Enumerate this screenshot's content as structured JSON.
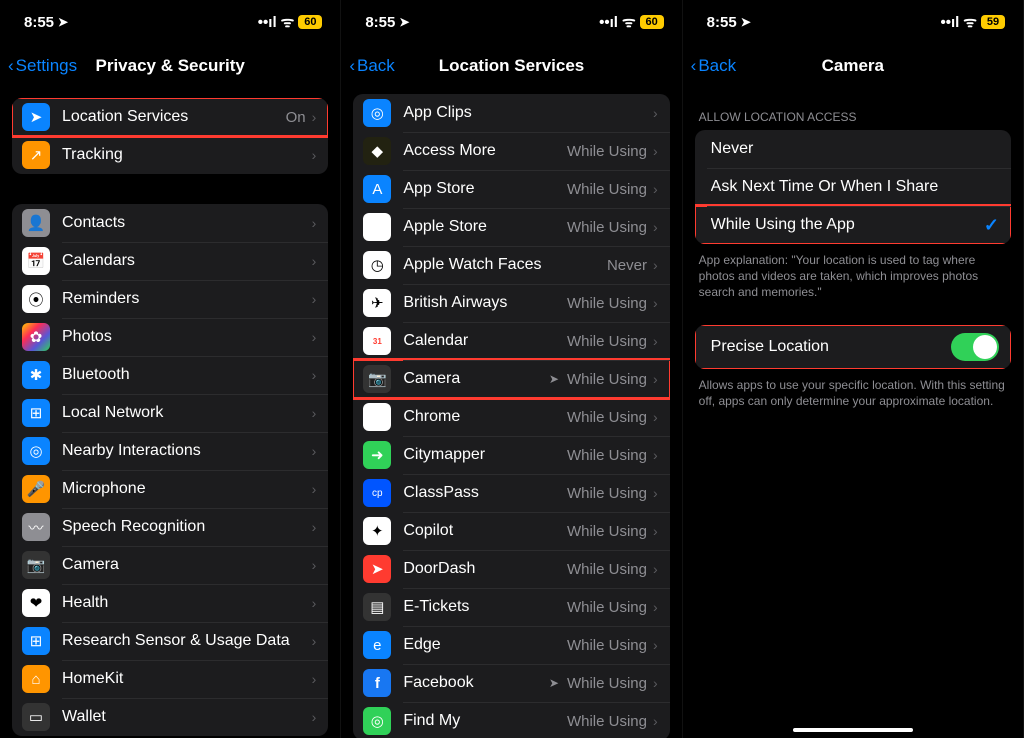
{
  "panel1": {
    "status": {
      "time": "8:55",
      "battery": "60"
    },
    "nav": {
      "back": "Settings",
      "title": "Privacy & Security"
    },
    "group1": [
      {
        "label": "Location Services",
        "detail": "On",
        "icon": "location-arrow-icon",
        "cls": "ic-blue",
        "glyph": "➤",
        "highlight": true
      },
      {
        "label": "Tracking",
        "icon": "tracking-icon",
        "cls": "ic-orange",
        "glyph": "↗"
      }
    ],
    "group2": [
      {
        "label": "Contacts",
        "icon": "contacts-icon",
        "cls": "ic-grey",
        "glyph": "👤"
      },
      {
        "label": "Calendars",
        "icon": "calendar-icon",
        "cls": "ic-white",
        "glyph": "📅"
      },
      {
        "label": "Reminders",
        "icon": "reminders-icon",
        "cls": "ic-white",
        "glyph": "⦿"
      },
      {
        "label": "Photos",
        "icon": "photos-icon",
        "cls": "ic-multicolor",
        "glyph": "✿"
      },
      {
        "label": "Bluetooth",
        "icon": "bluetooth-icon",
        "cls": "ic-blue",
        "glyph": "✱"
      },
      {
        "label": "Local Network",
        "icon": "local-network-icon",
        "cls": "ic-blue",
        "glyph": "⊞"
      },
      {
        "label": "Nearby Interactions",
        "icon": "nearby-icon",
        "cls": "ic-blue",
        "glyph": "◎"
      },
      {
        "label": "Microphone",
        "icon": "microphone-icon",
        "cls": "ic-orange",
        "glyph": "🎤"
      },
      {
        "label": "Speech Recognition",
        "icon": "speech-icon",
        "cls": "ic-grey",
        "glyph": "〰"
      },
      {
        "label": "Camera",
        "icon": "camera-icon",
        "cls": "ic-dark",
        "glyph": "📷"
      },
      {
        "label": "Health",
        "icon": "health-icon",
        "cls": "ic-white",
        "glyph": "❤"
      },
      {
        "label": "Research Sensor & Usage Data",
        "icon": "research-icon",
        "cls": "ic-blue",
        "glyph": "⊞"
      },
      {
        "label": "HomeKit",
        "icon": "homekit-icon",
        "cls": "ic-orange",
        "glyph": "⌂"
      },
      {
        "label": "Wallet",
        "icon": "wallet-icon",
        "cls": "ic-dark",
        "glyph": "▭"
      }
    ]
  },
  "panel2": {
    "status": {
      "time": "8:55",
      "battery": "60"
    },
    "nav": {
      "back": "Back",
      "title": "Location Services"
    },
    "apps": [
      {
        "label": "App Clips",
        "detail": "",
        "icon": "app-clips-icon",
        "cls": "ic-blue",
        "glyph": "◎"
      },
      {
        "label": "Access More",
        "detail": "While Using",
        "icon": "access-more-icon",
        "cls": "ic-amore",
        "glyph": "◆"
      },
      {
        "label": "App Store",
        "detail": "While Using",
        "icon": "app-store-icon",
        "cls": "ic-blue",
        "glyph": "A"
      },
      {
        "label": "Apple Store",
        "detail": "While Using",
        "icon": "apple-store-icon",
        "cls": "ic-white",
        "glyph": ""
      },
      {
        "label": "Apple Watch Faces",
        "detail": "Never",
        "icon": "watch-faces-icon",
        "cls": "ic-white",
        "glyph": "◷"
      },
      {
        "label": "British Airways",
        "detail": "While Using",
        "icon": "british-airways-icon",
        "cls": "ic-white",
        "glyph": "✈"
      },
      {
        "label": "Calendar",
        "detail": "While Using",
        "icon": "calendar-icon",
        "cls": "ic-calendar",
        "glyph": "31"
      },
      {
        "label": "Camera",
        "detail": "While Using",
        "icon": "camera-icon",
        "cls": "ic-dark",
        "glyph": "📷",
        "arrow": true,
        "highlight": true
      },
      {
        "label": "Chrome",
        "detail": "While Using",
        "icon": "chrome-icon",
        "cls": "ic-chrome",
        "glyph": "◉"
      },
      {
        "label": "Citymapper",
        "detail": "While Using",
        "icon": "citymapper-icon",
        "cls": "ic-green",
        "glyph": "➜"
      },
      {
        "label": "ClassPass",
        "detail": "While Using",
        "icon": "classpass-icon",
        "cls": "ic-classpass",
        "glyph": "cp"
      },
      {
        "label": "Copilot",
        "detail": "While Using",
        "icon": "copilot-icon",
        "cls": "ic-white",
        "glyph": "✦"
      },
      {
        "label": "DoorDash",
        "detail": "While Using",
        "icon": "doordash-icon",
        "cls": "ic-red",
        "glyph": "➤"
      },
      {
        "label": "E-Tickets",
        "detail": "While Using",
        "icon": "etickets-icon",
        "cls": "ic-dark",
        "glyph": "▤"
      },
      {
        "label": "Edge",
        "detail": "While Using",
        "icon": "edge-icon",
        "cls": "ic-edge",
        "glyph": "e"
      },
      {
        "label": "Facebook",
        "detail": "While Using",
        "icon": "facebook-icon",
        "cls": "ic-facebook",
        "glyph": "f",
        "arrow": true
      },
      {
        "label": "Find My",
        "detail": "While Using",
        "icon": "find-my-icon",
        "cls": "ic-green",
        "glyph": "◎"
      }
    ]
  },
  "panel3": {
    "status": {
      "time": "8:55",
      "battery": "59"
    },
    "nav": {
      "back": "Back",
      "title": "Camera"
    },
    "section_header": "ALLOW LOCATION ACCESS",
    "options": [
      {
        "label": "Never",
        "selected": false
      },
      {
        "label": "Ask Next Time Or When I Share",
        "selected": false
      },
      {
        "label": "While Using the App",
        "selected": true,
        "highlight": true
      }
    ],
    "explanation": "App explanation: \"Your location is used to tag where photos and videos are taken, which improves photos search and memories.\"",
    "precise": {
      "label": "Precise Location",
      "on": true,
      "highlight": true
    },
    "precise_footer": "Allows apps to use your specific location. With this setting off, apps can only determine your approximate location."
  }
}
